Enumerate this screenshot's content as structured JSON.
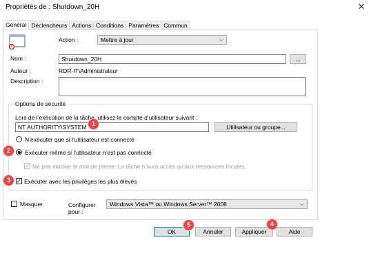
{
  "window": {
    "title": "Propriétés de : Shutdown_20H"
  },
  "tabs": [
    "Général",
    "Déclencheurs",
    "Actions",
    "Conditions",
    "Paramètres",
    "Commun"
  ],
  "general": {
    "action_label": "Action :",
    "action_value": "Mettre à jour",
    "name_label": "Nom :",
    "name_value": "Shutdown_20H",
    "browse_label": "...",
    "author_label": "Auteur :",
    "author_value": "RDR-IT\\Administrateur",
    "description_label": "Description :",
    "description_value": ""
  },
  "security": {
    "title": "Options de sécurité",
    "run_as_text": "Lors de l’exécution de la tâche, utilisez le compte d’utilisateur suivant :",
    "account_value": "NT AUTHORITY\\SYSTEM",
    "user_group_button": "Utilisateur ou groupe...",
    "radio_logged_on": "N’exécuter que si l’utilisateur est connecté",
    "radio_whether_logged": "Exécuter même si l’utilisateur n’est pas connecté",
    "no_store_password": "Ne pas stocker le mot de passe. La tâche n’aura accès qu’aux ressources locales.",
    "highest_privileges": "Exécuter avec les privilèges les plus élevés"
  },
  "bottom": {
    "hidden_label": "Masquer",
    "configure_label": "Configurer pour :",
    "configure_value": "Windows Vista™ ou Windows Server™ 2008"
  },
  "buttons": {
    "ok": "OK",
    "cancel": "Annuler",
    "apply": "Appliquer",
    "help": "Aide"
  },
  "badges": [
    "1",
    "2",
    "3",
    "4",
    "5"
  ],
  "colors": {
    "badge": "#e8454a",
    "accent": "#0078d7"
  }
}
